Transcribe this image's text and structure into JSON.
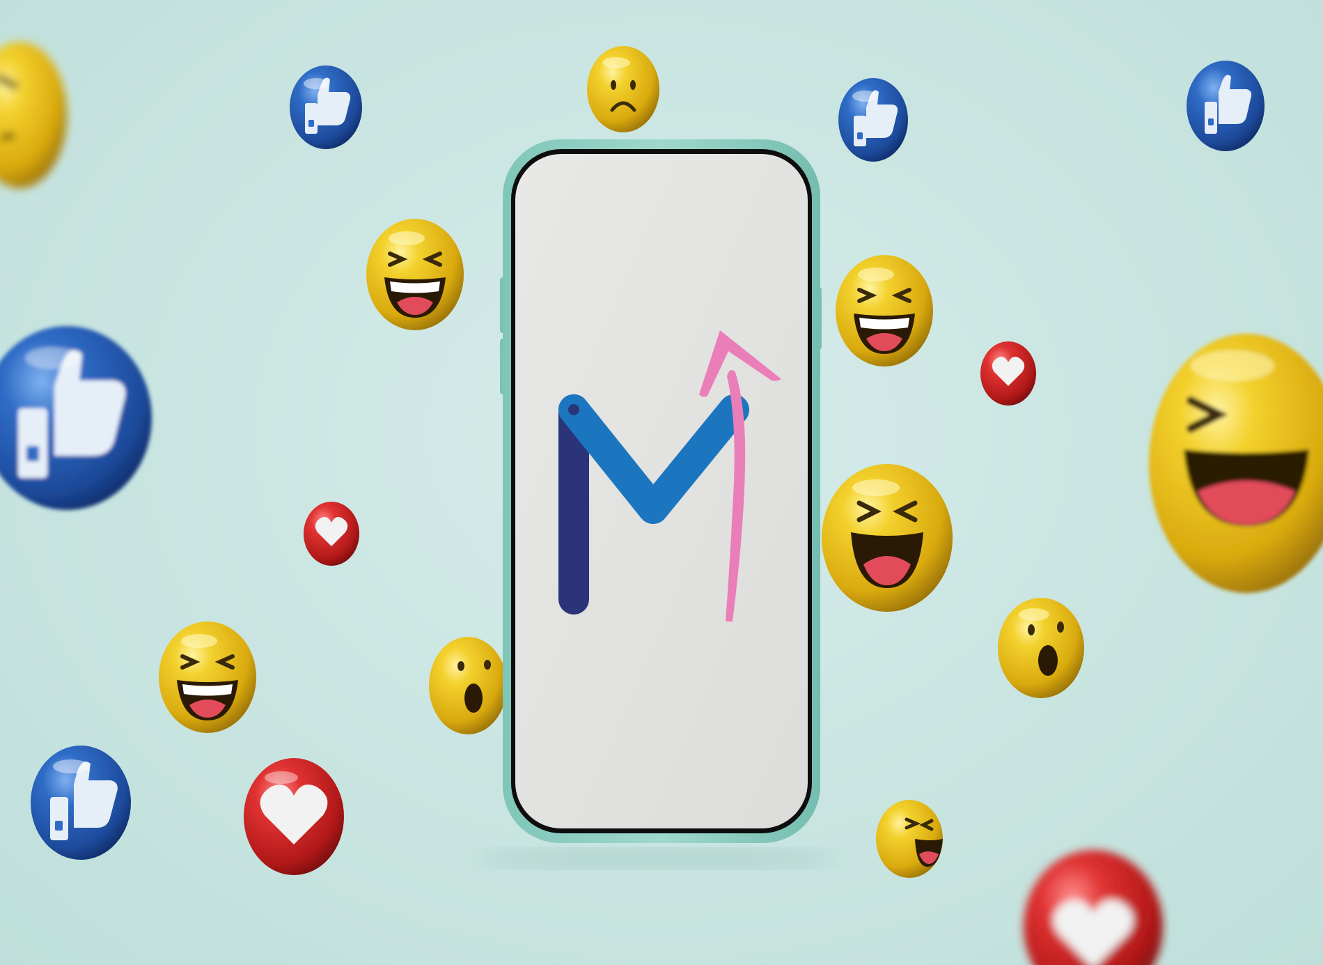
{
  "scene": {
    "background_color": "#cbe6e2",
    "subject": "smartphone",
    "logo": {
      "letter": "M",
      "colors": {
        "left_stroke": "#2b3479",
        "diagonals": "#1b76bf",
        "arrow": "#ea7eb8"
      }
    },
    "floating_icons": [
      {
        "type": "angry-emoji",
        "color": "#e8c21f"
      },
      {
        "type": "thumbs-up",
        "color": "#2a5db3"
      },
      {
        "type": "sad-emoji",
        "color": "#e8c21f"
      },
      {
        "type": "thumbs-up",
        "color": "#2a5db3"
      },
      {
        "type": "thumbs-up",
        "color": "#2a5db3"
      },
      {
        "type": "laughing-emoji",
        "color": "#e8c21f"
      },
      {
        "type": "laughing-emoji",
        "color": "#e8c21f"
      },
      {
        "type": "heart",
        "color": "#d42b2b"
      },
      {
        "type": "thumbs-up",
        "color": "#2a5db3"
      },
      {
        "type": "laughing-emoji",
        "color": "#e8c21f"
      },
      {
        "type": "heart",
        "color": "#d42b2b"
      },
      {
        "type": "laughing-emoji",
        "color": "#e8c21f"
      },
      {
        "type": "wow-emoji",
        "color": "#e8c21f"
      },
      {
        "type": "wow-emoji",
        "color": "#e8c21f"
      },
      {
        "type": "laughing-emoji",
        "color": "#e8c21f"
      },
      {
        "type": "thumbs-up",
        "color": "#2a5db3"
      },
      {
        "type": "heart",
        "color": "#d42b2b"
      },
      {
        "type": "laughing-emoji",
        "color": "#e8c21f"
      },
      {
        "type": "heart",
        "color": "#d42b2b"
      }
    ]
  }
}
